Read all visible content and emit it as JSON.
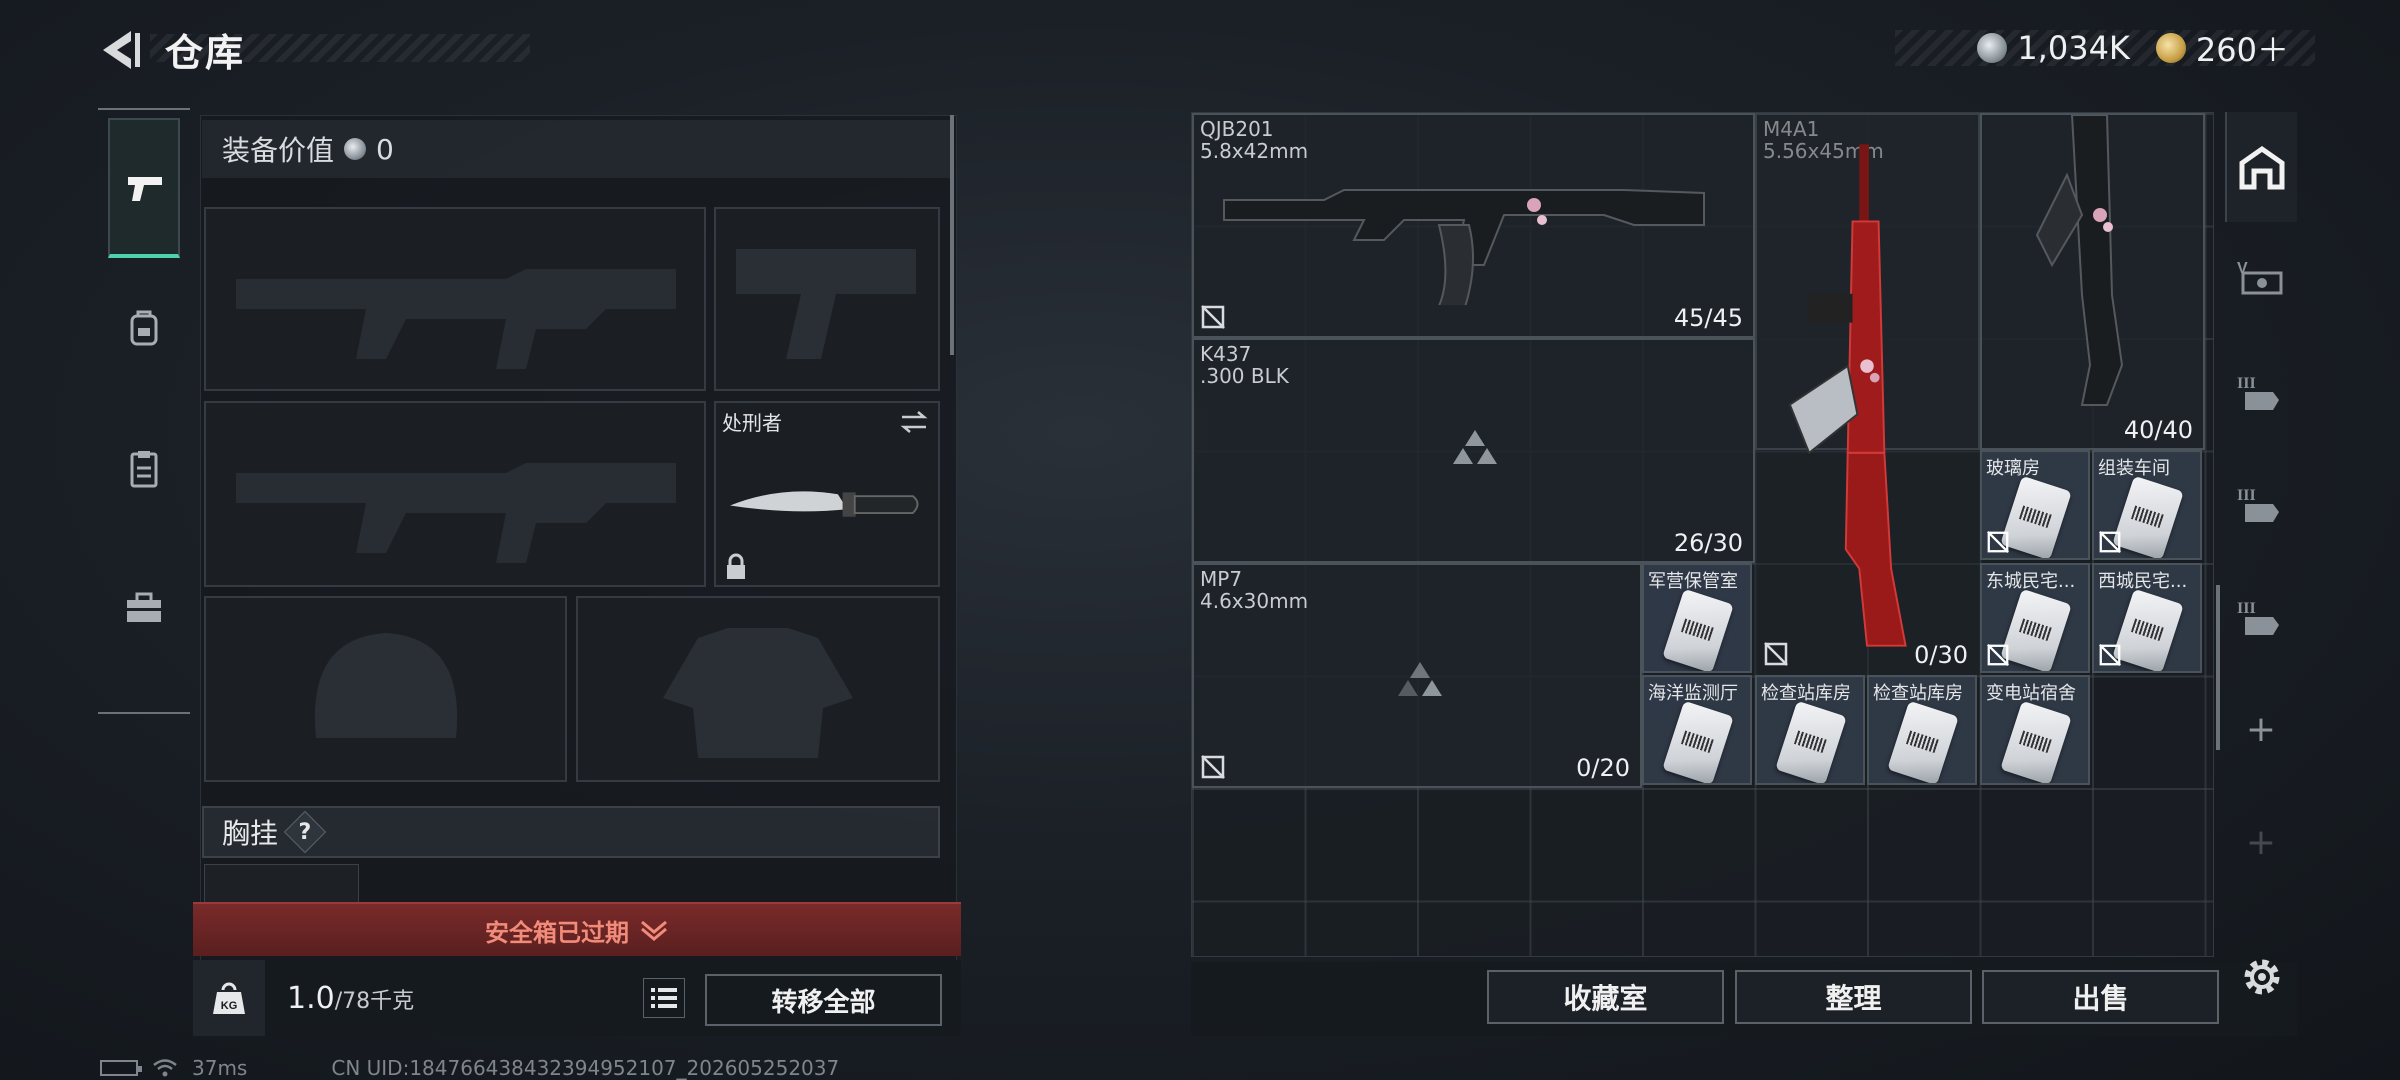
{
  "header": {
    "title": "仓库"
  },
  "currency": {
    "silver": "1,034K",
    "gold": "260＋"
  },
  "equipment": {
    "value_label": "装备价值",
    "value": "0",
    "melee_name": "处刑者",
    "vest_label": "胸挂",
    "vest_help": "?"
  },
  "safe_box": {
    "label": "安全箱已过期"
  },
  "inventory": {
    "weight_current": "1.0",
    "weight_max": "/78千克",
    "transfer_all": "转移全部"
  },
  "status": {
    "ping": "37ms",
    "uid": "CN UID:184766438432394952107_202605252037"
  },
  "items": [
    {
      "name": "QJB201",
      "caliber": "5.8x42mm",
      "ammo": "45/45"
    },
    {
      "name": "M4A1",
      "caliber": "5.56x45mm",
      "ammo": "40/40"
    },
    {
      "name": "K437",
      "caliber": ".300 BLK",
      "ammo": "26/30"
    },
    {
      "name": "MP7",
      "caliber": "4.6x30mm",
      "ammo": "0/20"
    },
    {
      "ammo": "0/30"
    }
  ],
  "keycards": [
    "玻璃房",
    "组装车间",
    "军营保管室",
    "东城民宅...",
    "西城民宅...",
    "海洋监测厅",
    "检查站库房",
    "检查站库房",
    "变电站宿舍"
  ],
  "bottom_buttons": {
    "collection": "收藏室",
    "organize": "整理",
    "sell": "出售"
  },
  "colors": {
    "accent": "#4fd0b0",
    "alert": "#7a2a2a",
    "alert_text": "#f28b7a"
  }
}
